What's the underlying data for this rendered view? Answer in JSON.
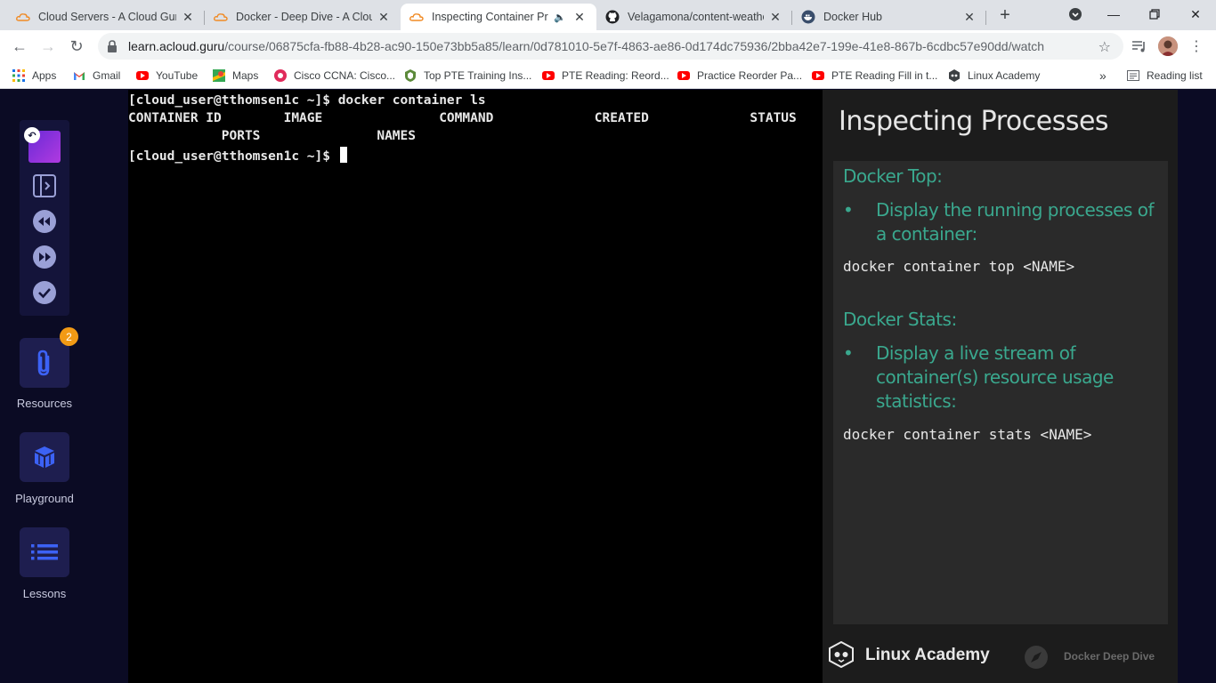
{
  "browser": {
    "tabs": [
      {
        "title": "Cloud Servers - A Cloud Guru",
        "icon": "acloudguru-icon",
        "active": false
      },
      {
        "title": "Docker - Deep Dive - A Cloud Guru",
        "icon": "acloudguru-icon",
        "active": false
      },
      {
        "title": "Inspecting Container Processes",
        "icon": "acloudguru-icon",
        "active": true
      },
      {
        "title": "Velagamona/content-weather",
        "icon": "github-icon",
        "active": false
      },
      {
        "title": "Docker Hub",
        "icon": "docker-icon",
        "active": false
      }
    ],
    "url_host": "learn.acloud.guru",
    "url_path": "/course/06875cfa-fb88-4b28-ac90-150e73bb5a85/learn/0d781010-5e7f-4863-ae86-0d174dc75936/2bba42e7-199e-41e8-867b-6cdbc57e90dd/watch",
    "bookmarks": [
      {
        "label": "Apps",
        "icon": "apps-grid-icon"
      },
      {
        "label": "Gmail",
        "icon": "gmail-icon"
      },
      {
        "label": "YouTube",
        "icon": "youtube-icon"
      },
      {
        "label": "Maps",
        "icon": "maps-icon"
      },
      {
        "label": "Cisco CCNA: Cisco...",
        "icon": "cisco-icon"
      },
      {
        "label": "Top PTE Training Ins...",
        "icon": "pte-icon"
      },
      {
        "label": "PTE Reading: Reord...",
        "icon": "youtube-icon"
      },
      {
        "label": "Practice Reorder Pa...",
        "icon": "youtube-icon"
      },
      {
        "label": "PTE Reading Fill in t...",
        "icon": "youtube-icon"
      },
      {
        "label": "Linux Academy",
        "icon": "linux-academy-icon"
      }
    ],
    "more_bookmarks": "»",
    "reading_list": "Reading list"
  },
  "sidebar": {
    "resources_label": "Resources",
    "resources_badge": "2",
    "playground_label": "Playground",
    "lessons_label": "Lessons",
    "accent": "#3c62f5"
  },
  "terminal": {
    "line1": "[cloud_user@tthomsen1c ~]$ docker container ls",
    "line2": "CONTAINER ID        IMAGE               COMMAND             CREATED             STATUS",
    "line3": "            PORTS               NAMES",
    "prompt": "[cloud_user@tthomsen1c ~]$ "
  },
  "slide": {
    "title": "Inspecting Processes",
    "section1_heading": "Docker Top:",
    "section1_bullet": "Display the running processes of a container:",
    "section1_code": "docker container top <NAME>",
    "section2_heading": "Docker Stats:",
    "section2_bullet": "Display a live stream of container(s) resource usage statistics:",
    "section2_code": "docker container stats <NAME>",
    "brand": "Linux Academy",
    "course": "Docker Deep Dive",
    "accent": "#3aa88e"
  }
}
